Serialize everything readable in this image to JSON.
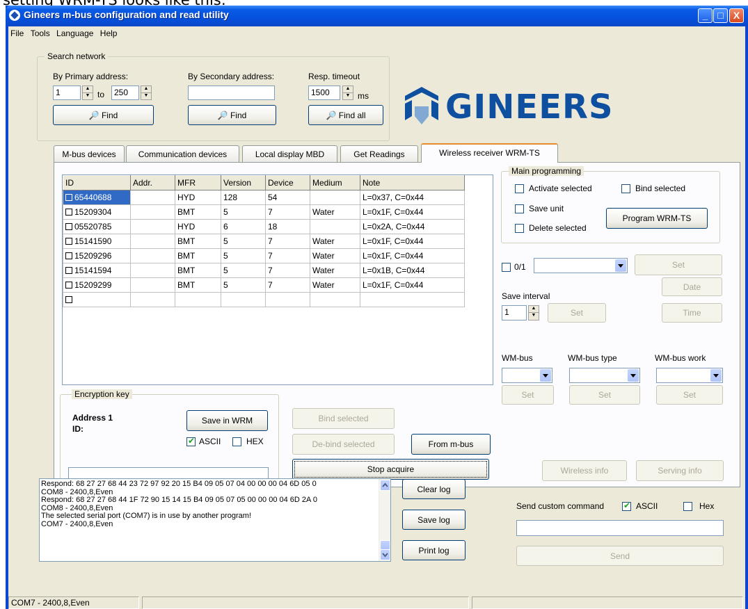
{
  "caption": "setting WRM-TS looks like this:",
  "window": {
    "title": "Gineers m-bus configuration and read utility",
    "minimize_glyph": "_",
    "maximize_glyph": "□",
    "close_glyph": "X"
  },
  "menu": [
    "File",
    "Tools",
    "Language",
    "Help"
  ],
  "search": {
    "group_label": "Search network",
    "primary_label": "By Primary address:",
    "primary_from": "1",
    "to_label": "to",
    "primary_to": "250",
    "secondary_label": "By Secondary address:",
    "secondary_value": "",
    "timeout_label": "Resp. timeout",
    "timeout_value": "1500",
    "ms_label": "ms",
    "find_label": "Find",
    "find_all_label": "Find all"
  },
  "logo": {
    "text": "GINEERS",
    "color": "#0f4fa0"
  },
  "tabs": [
    "M-bus devices",
    "Communication devices",
    "Local display MBD",
    "Get Readings",
    "Wireless receiver WRM-TS"
  ],
  "active_tab": 4,
  "grid": {
    "columns": [
      "ID",
      "Addr.",
      "MFR",
      "Version",
      "Device",
      "Medium",
      "Note"
    ],
    "rows": [
      {
        "id": "65440688",
        "addr": "",
        "mfr": "HYD",
        "version": "128",
        "device": "54",
        "medium": "",
        "note": "L=0x37, C=0x44"
      },
      {
        "id": "15209304",
        "addr": "",
        "mfr": "BMT",
        "version": "5",
        "device": "7",
        "medium": "Water",
        "note": "L=0x1F, C=0x44"
      },
      {
        "id": "05520785",
        "addr": "",
        "mfr": "HYD",
        "version": "6",
        "device": "18",
        "medium": "",
        "note": "L=0x2A, C=0x44"
      },
      {
        "id": "15141590",
        "addr": "",
        "mfr": "BMT",
        "version": "5",
        "device": "7",
        "medium": "Water",
        "note": "L=0x1F, C=0x44"
      },
      {
        "id": "15209296",
        "addr": "",
        "mfr": "BMT",
        "version": "5",
        "device": "7",
        "medium": "Water",
        "note": "L=0x1F, C=0x44"
      },
      {
        "id": "15141594",
        "addr": "",
        "mfr": "BMT",
        "version": "5",
        "device": "7",
        "medium": "Water",
        "note": "L=0x1B, C=0x44"
      },
      {
        "id": "15209299",
        "addr": "",
        "mfr": "BMT",
        "version": "5",
        "device": "7",
        "medium": "Water",
        "note": "L=0x1F, C=0x44"
      },
      {
        "id": "",
        "addr": "",
        "mfr": "",
        "version": "",
        "device": "",
        "medium": "",
        "note": ""
      }
    ]
  },
  "main_programming": {
    "group_label": "Main programming",
    "activate_selected": "Activate selected",
    "bind_selected": "Bind selected",
    "save_unit": "Save unit",
    "delete_selected": "Delete selected",
    "program_button": "Program WRM-TS"
  },
  "right_controls": {
    "toggle_label": "0/1",
    "set_label": "Set",
    "date_label": "Date",
    "time_label": "Time",
    "save_interval_label": "Save interval",
    "save_interval_value": "1",
    "wmbus_label": "WM-bus",
    "wmbus_type_label": "WM-bus type",
    "wmbus_work_label": "WM-bus work",
    "wireless_info": "Wireless info",
    "serving_info": "Serving info"
  },
  "encryption": {
    "group_label": "Encryption key",
    "address_label": "Address 1",
    "id_label": "ID:",
    "save_in_wrm": "Save in WRM",
    "ascii_label": "ASCII",
    "hex_label": "HEX",
    "key_value": ""
  },
  "actions": {
    "bind_selected": "Bind selected",
    "debind_selected": "De-bind selected",
    "from_mbus": "From m-bus",
    "stop_acquire": "Stop acquire"
  },
  "log": {
    "lines": [
      "Respond: 68 27 27 68 44 23 72 97 92 20 15 B4 09 05 07 04 00 00 00 04 6D 05 0",
      "COM8 - 2400,8,Even",
      "Respond: 68 27 27 68 44 1F 72 90 15 14 15 B4 09 05 07 05 00 00 00 04 6D 2A 0",
      "COM8 - 2400,8,Even",
      "The selected serial port (COM7) is in use by another program!",
      "COM7 - 2400,8,Even"
    ],
    "clear": "Clear log",
    "save": "Save log",
    "print": "Print log"
  },
  "custom": {
    "label": "Send custom command",
    "ascii": "ASCII",
    "hex": "Hex",
    "value": "",
    "send": "Send"
  },
  "status": {
    "port": "COM7 - 2400,8,Even"
  }
}
